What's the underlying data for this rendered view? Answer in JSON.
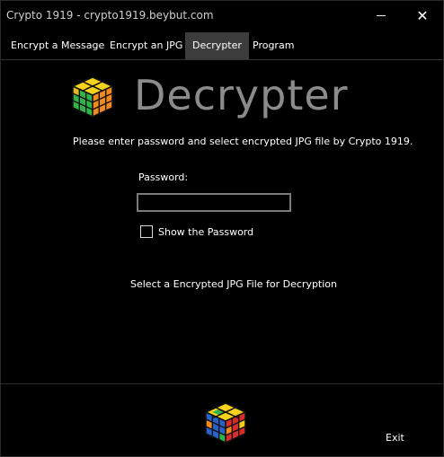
{
  "window": {
    "title": "Crypto 1919 - crypto1919.beybut.com"
  },
  "tabs": [
    {
      "label": "Encrypt a Message"
    },
    {
      "label": "Encrypt an JPG"
    },
    {
      "label": "Decrypter",
      "selected": true
    },
    {
      "label": "Program"
    }
  ],
  "header": {
    "title": "Decrypter"
  },
  "main": {
    "instruction": "Please enter password and select encrypted JPG file by Crypto 1919.",
    "password_label": "Password:",
    "password_value": "",
    "show_password_label": "Show the Password",
    "show_password_checked": false,
    "select_file_label": "Select a Encrypted JPG File for Decryption"
  },
  "footer": {
    "exit_label": "Exit"
  },
  "icons": {
    "logo": "rubiks-cube-icon",
    "minimize": "minimize-icon",
    "close": "close-icon"
  },
  "colors": {
    "background": "#000000",
    "selected_tab": "#3c3c3c",
    "title_text": "#8b8b8b"
  }
}
